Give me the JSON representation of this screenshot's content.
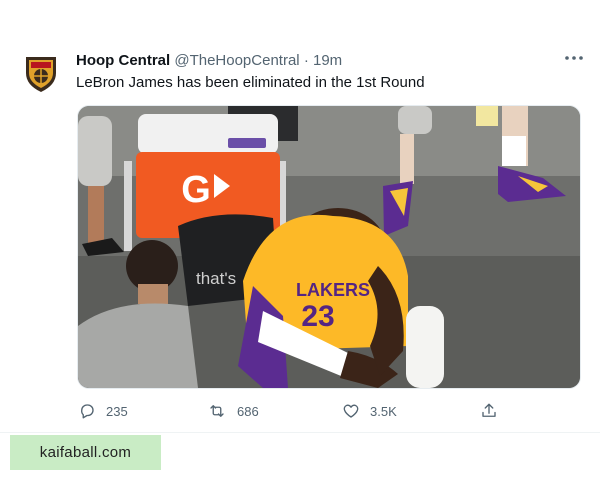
{
  "tweet": {
    "display_name": "Hoop Central",
    "handle": "@TheHoopCentral",
    "separator": "·",
    "time": "19m",
    "text": "LeBron James has been eliminated in the 1st Round",
    "actions": {
      "replies": "235",
      "retweets": "686",
      "likes": "3.5K"
    },
    "media": {
      "cooler_logo": "G",
      "cooler_brand": "GATORADE",
      "jersey_text": "LAKERS",
      "jersey_number": "23",
      "chair_text": "that's"
    }
  },
  "icons": {
    "avatar": "hoop-central-logo",
    "more": "more-dots-icon",
    "reply": "reply-icon",
    "retweet": "retweet-icon",
    "like": "heart-icon",
    "share": "share-icon"
  },
  "colors": {
    "text": "#0f1419",
    "muted": "#536471",
    "watermark_bg": "#c9ecc5"
  },
  "watermark": {
    "text": "kaifaball.com"
  }
}
